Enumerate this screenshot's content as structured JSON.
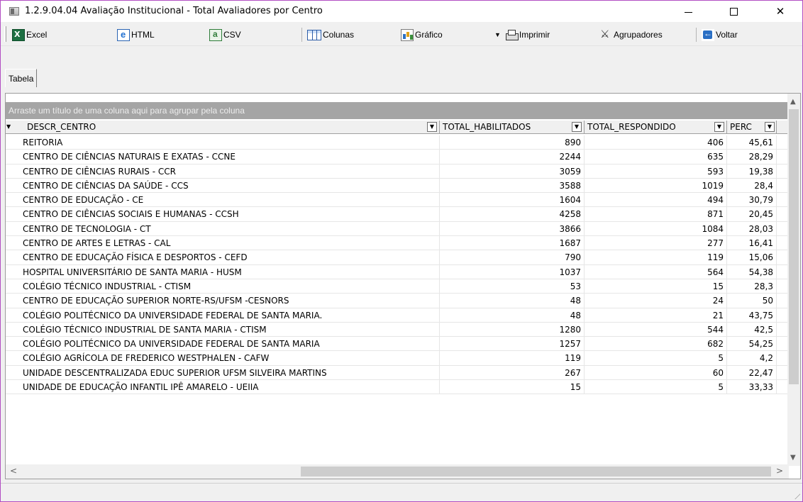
{
  "window": {
    "title": "1.2.9.04.04 Avaliação Institucional - Total Avaliadores por Centro"
  },
  "toolbar": {
    "excel": "Excel",
    "html": "HTML",
    "csv": "CSV",
    "colunas": "Colunas",
    "grafico": "Gráfico",
    "imprimir": "Imprimir",
    "agrupadores": "Agrupadores",
    "voltar": "Voltar"
  },
  "tabs": [
    "Tabela"
  ],
  "grid": {
    "group_hint": "Arraste um título de uma coluna aqui para agrupar pela coluna",
    "columns": [
      "DESCR_CENTRO",
      "TOTAL_HABILITADOS",
      "TOTAL_RESPONDIDO",
      "PERC"
    ],
    "rows": [
      [
        "REITORIA",
        "890",
        "406",
        "45,61"
      ],
      [
        "CENTRO DE CIÊNCIAS NATURAIS E EXATAS - CCNE",
        "2244",
        "635",
        "28,29"
      ],
      [
        "CENTRO DE CIÊNCIAS RURAIS - CCR",
        "3059",
        "593",
        "19,38"
      ],
      [
        "CENTRO DE CIÊNCIAS DA SAÚDE - CCS",
        "3588",
        "1019",
        "28,4"
      ],
      [
        "CENTRO DE EDUCAÇÃO - CE",
        "1604",
        "494",
        "30,79"
      ],
      [
        "CENTRO DE CIÊNCIAS SOCIAIS E HUMANAS - CCSH",
        "4258",
        "871",
        "20,45"
      ],
      [
        "CENTRO DE TECNOLOGIA - CT",
        "3866",
        "1084",
        "28,03"
      ],
      [
        "CENTRO DE ARTES E LETRAS - CAL",
        "1687",
        "277",
        "16,41"
      ],
      [
        "CENTRO DE EDUCAÇÃO FÍSICA E DESPORTOS - CEFD",
        "790",
        "119",
        "15,06"
      ],
      [
        "HOSPITAL UNIVERSITÁRIO DE SANTA MARIA - HUSM",
        "1037",
        "564",
        "54,38"
      ],
      [
        "COLÉGIO TÉCNICO INDUSTRIAL - CTISM",
        "53",
        "15",
        "28,3"
      ],
      [
        "CENTRO DE EDUCAÇÃO SUPERIOR NORTE-RS/UFSM -CESNORS",
        "48",
        "24",
        "50"
      ],
      [
        "COLÉGIO POLITÉCNICO DA UNIVERSIDADE FEDERAL DE SANTA MARIA.",
        "48",
        "21",
        "43,75"
      ],
      [
        "COLÉGIO TÉCNICO INDUSTRIAL DE SANTA MARIA - CTISM",
        "1280",
        "544",
        "42,5"
      ],
      [
        "COLÉGIO POLITÉCNICO DA UNIVERSIDADE FEDERAL DE SANTA MARIA",
        "1257",
        "682",
        "54,25"
      ],
      [
        "COLÉGIO AGRÍCOLA DE FREDERICO WESTPHALEN - CAFW",
        "119",
        "5",
        "4,2"
      ],
      [
        "UNIDADE DESCENTRALIZADA EDUC SUPERIOR UFSM SILVEIRA MARTINS",
        "267",
        "60",
        "22,47"
      ],
      [
        "UNIDADE DE EDUCAÇÃO INFANTIL IPÊ AMARELO - UEIIA",
        "15",
        "5",
        "33,33"
      ]
    ]
  }
}
